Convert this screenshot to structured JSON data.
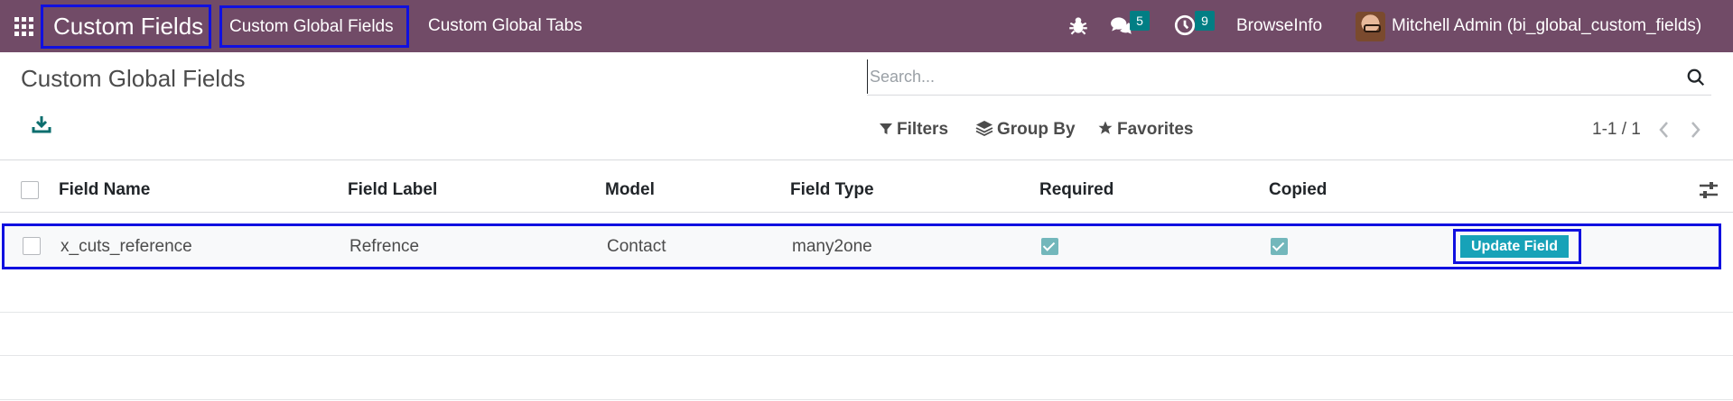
{
  "navbar": {
    "app_title": "Custom Fields",
    "menu": [
      "Custom Global Fields",
      "Custom Global Tabs"
    ],
    "messages_count": "5",
    "activities_count": "9",
    "company": "BrowseInfo",
    "user": "Mitchell Admin (bi_global_custom_fields)",
    "colors": {
      "bar": "#714b67",
      "badge": "#017e84",
      "highlight": "#1010e0"
    }
  },
  "control_panel": {
    "title": "Custom Global Fields",
    "search_placeholder": "Search...",
    "filters_label": "Filters",
    "group_by_label": "Group By",
    "favorites_label": "Favorites",
    "pager": "1-1 / 1"
  },
  "table": {
    "columns": [
      "Field Name",
      "Field Label",
      "Model",
      "Field Type",
      "Required",
      "Copied"
    ],
    "rows": [
      {
        "field_name": "x_cuts_reference",
        "field_label": "Refrence",
        "model": "Contact",
        "field_type": "many2one",
        "required": true,
        "copied": true,
        "action_label": "Update Field"
      }
    ]
  }
}
